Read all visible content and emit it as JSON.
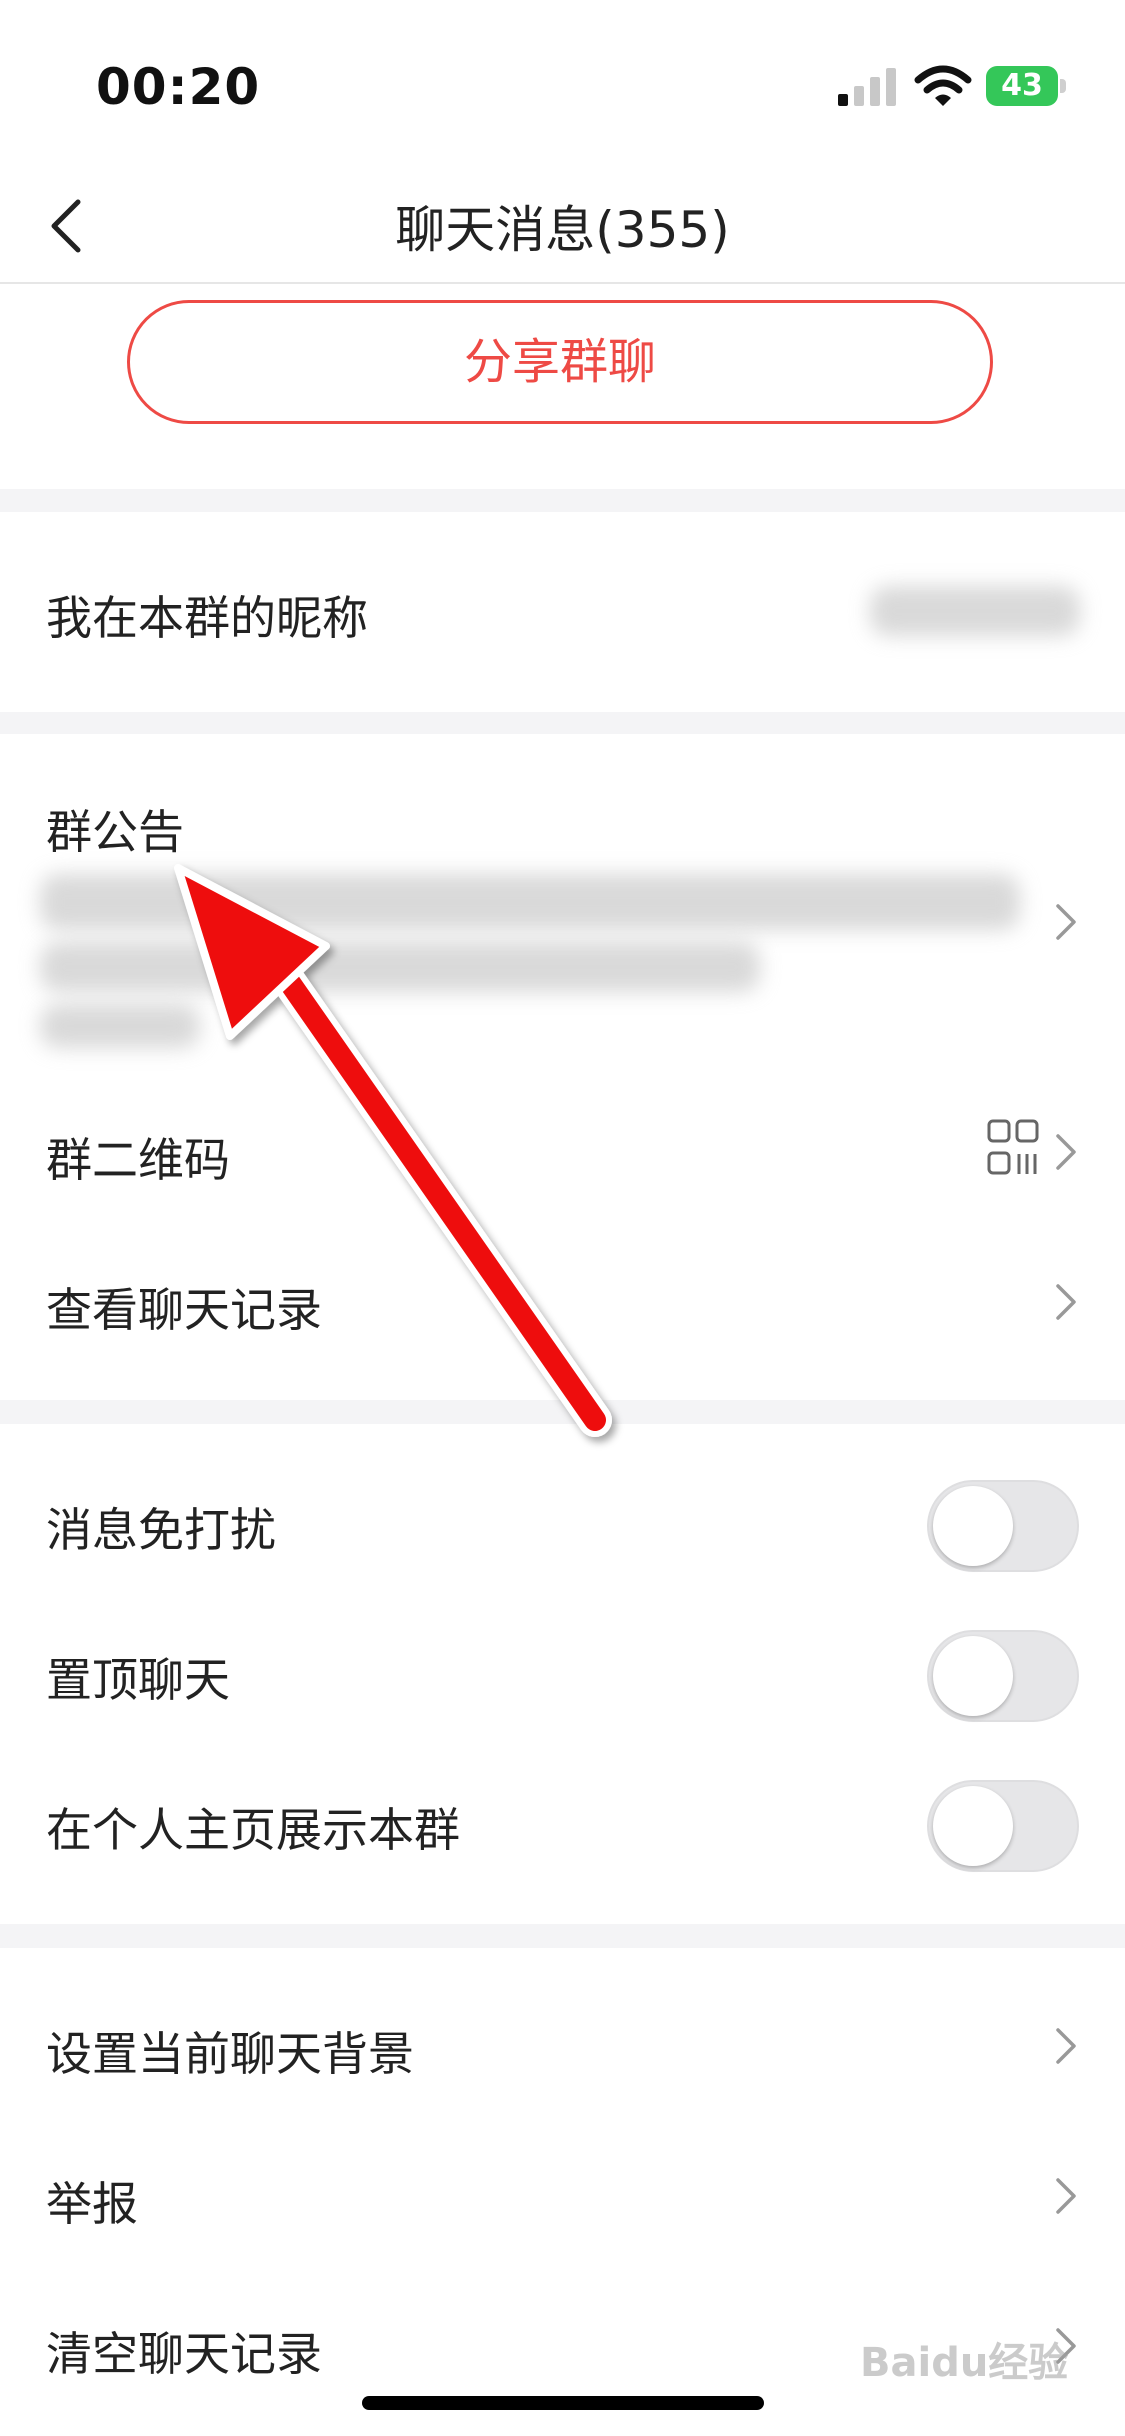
{
  "status": {
    "time": "00:20",
    "battery": "43"
  },
  "nav": {
    "title": "聊天消息(355)"
  },
  "share": {
    "label": "分享群聊"
  },
  "nickname": {
    "label": "我在本群的昵称"
  },
  "announcement": {
    "label": "群公告"
  },
  "qrcode": {
    "label": "群二维码"
  },
  "history": {
    "label": "查看聊天记录"
  },
  "toggles": [
    {
      "label": "消息免打扰",
      "on": false
    },
    {
      "label": "置顶聊天",
      "on": false
    },
    {
      "label": "在个人主页展示本群",
      "on": false
    }
  ],
  "bottom_items": [
    {
      "label": "设置当前聊天背景"
    },
    {
      "label": "举报"
    },
    {
      "label": "清空聊天记录"
    }
  ],
  "watermark": "Baidu经验",
  "colors": {
    "accent": "#ee4a45",
    "battery": "#34c759",
    "arrow": "#ee1111"
  },
  "icons": [
    "back-chevron-icon",
    "chevron-right-icon",
    "qr-code-icon",
    "signal-icon",
    "wifi-icon",
    "battery-icon"
  ]
}
